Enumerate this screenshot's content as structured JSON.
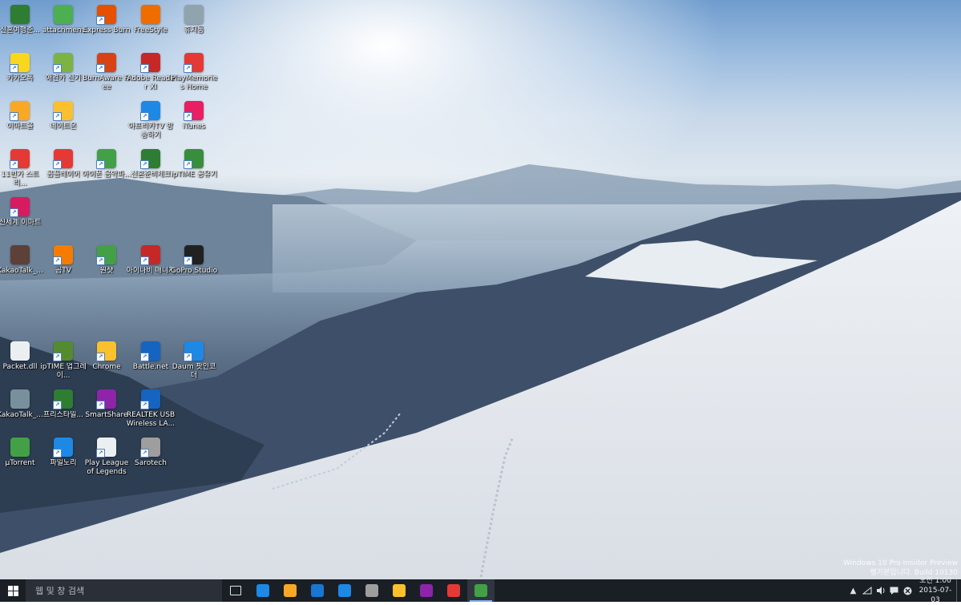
{
  "desktop": {
    "icons": [
      {
        "label": "신혼여행준...",
        "icon": "document-icon",
        "color": "#2e7d32",
        "shortcut": false
      },
      {
        "label": "attachment",
        "icon": "document-icon",
        "color": "#4caf50",
        "shortcut": false
      },
      {
        "label": "Express Burn",
        "icon": "burn-disc-icon",
        "color": "#e65100",
        "shortcut": true
      },
      {
        "label": "FreeStyle",
        "icon": "basketball-icon",
        "color": "#ef6c00",
        "shortcut": false
      },
      {
        "label": "휴지통",
        "icon": "recycle-bin-icon",
        "color": "#90a4ae",
        "shortcut": false
      },
      {
        "label": "카카오톡",
        "icon": "kakaotalk-icon",
        "color": "#f9d71c",
        "shortcut": true
      },
      {
        "label": "애견카 신기",
        "icon": "document-icon",
        "color": "#7cb342",
        "shortcut": true
      },
      {
        "label": "BurnAware Free",
        "icon": "burnaware-icon",
        "color": "#d84315",
        "shortcut": true
      },
      {
        "label": "Adobe Reader XI",
        "icon": "adobe-reader-icon",
        "color": "#c62828",
        "shortcut": true
      },
      {
        "label": "PlayMemories Home",
        "icon": "playmemories-icon",
        "color": "#e53935",
        "shortcut": true
      },
      {
        "label": "이마트몰",
        "icon": "emart-mall-icon",
        "color": "#f9a825",
        "shortcut": true
      },
      {
        "label": "네이트온",
        "icon": "nateon-icon",
        "color": "#fbc02d",
        "shortcut": true
      },
      {
        "label": "아프리카TV 방송하기",
        "icon": "afreecatv-icon",
        "color": "#1e88e5",
        "shortcut": true
      },
      {
        "label": "iTunes",
        "icon": "itunes-icon",
        "color": "#e91e63",
        "shortcut": true
      },
      {
        "label": "11번가 스트리...",
        "icon": "11st-icon",
        "color": "#e53935",
        "shortcut": true
      },
      {
        "label": "곰플레이어",
        "icon": "gomplayer-icon",
        "color": "#e53935",
        "shortcut": true
      },
      {
        "label": "아이폰 음악파...",
        "icon": "document-icon",
        "color": "#43a047",
        "shortcut": true
      },
      {
        "label": "신혼준비체크",
        "icon": "spreadsheet-icon",
        "color": "#2e7d32",
        "shortcut": true
      },
      {
        "label": "ipTIME 공유기",
        "icon": "iptime-icon",
        "color": "#388e3c",
        "shortcut": true
      },
      {
        "label": "신세계 이마트",
        "icon": "ssg-icon",
        "color": "#d81b60",
        "shortcut": true
      },
      {
        "label": "KakaoTalk_...",
        "icon": "image-file-icon",
        "color": "#5d4037",
        "shortcut": false
      },
      {
        "label": "곰TV",
        "icon": "gomtv-icon",
        "color": "#f57c00",
        "shortcut": true
      },
      {
        "label": "원샷",
        "icon": "oneshot-icon",
        "color": "#43a047",
        "shortcut": true
      },
      {
        "label": "아이나비 매니저",
        "icon": "inavi-icon",
        "color": "#c62828",
        "shortcut": true
      },
      {
        "label": "GoPro Studio",
        "icon": "gopro-icon",
        "color": "#212121",
        "shortcut": true
      },
      {
        "label": "Packet.dll",
        "icon": "dll-file-icon",
        "color": "#eceff1",
        "shortcut": false
      },
      {
        "label": "ipTIME 업그레이...",
        "icon": "iptime-upgrade-icon",
        "color": "#558b2f",
        "shortcut": true
      },
      {
        "label": "Chrome",
        "icon": "chrome-icon",
        "color": "#fbc02d",
        "shortcut": true
      },
      {
        "label": "Battle.net",
        "icon": "battlenet-icon",
        "color": "#1565c0",
        "shortcut": true
      },
      {
        "label": "Daum 팟인코더",
        "icon": "daum-potencoder-icon",
        "color": "#1e88e5",
        "shortcut": true
      },
      {
        "label": "KakaoTalk_...",
        "icon": "image-file-icon",
        "color": "#78909c",
        "shortcut": false
      },
      {
        "label": "프리스타일...",
        "icon": "freestyle-z-icon",
        "color": "#2e7d32",
        "shortcut": true
      },
      {
        "label": "SmartShare",
        "icon": "smartshare-icon",
        "color": "#8e24aa",
        "shortcut": true
      },
      {
        "label": "REALTEK USB Wireless LA...",
        "icon": "realtek-icon",
        "color": "#1565c0",
        "shortcut": true
      },
      {
        "label": "µTorrent",
        "icon": "utorrent-icon",
        "color": "#43a047",
        "shortcut": false
      },
      {
        "label": "파일노리",
        "icon": "filenori-icon",
        "color": "#1e88e5",
        "shortcut": true
      },
      {
        "label": "Play League of Legends",
        "icon": "document-icon",
        "color": "#eceff1",
        "shortcut": true
      },
      {
        "label": "Sarotech",
        "icon": "sarotech-icon",
        "color": "#9e9e9e",
        "shortcut": true
      }
    ],
    "watermark": {
      "line1": "Windows 10 Pro Insider Preview",
      "line2": "평가본입니다. Build 10130"
    }
  },
  "taskbar": {
    "search_placeholder": "웹 및 창 검색",
    "pinned": [
      {
        "name": "task-view-icon",
        "color": "#1a1f26",
        "active": false
      },
      {
        "name": "windows-store-blue-icon",
        "color": "#1e88e5",
        "active": false
      },
      {
        "name": "file-explorer-icon",
        "color": "#f9a825",
        "active": false
      },
      {
        "name": "store-icon",
        "color": "#1976d2",
        "active": false
      },
      {
        "name": "internet-explorer-icon",
        "color": "#1e88e5",
        "active": false
      },
      {
        "name": "paint-app-icon",
        "color": "#9e9e9e",
        "active": false
      },
      {
        "name": "chrome-icon",
        "color": "#fbc02d",
        "active": false
      },
      {
        "name": "smartshare-icon",
        "color": "#8e24aa",
        "active": false
      },
      {
        "name": "gomplayer-icon",
        "color": "#e53935",
        "active": false
      },
      {
        "name": "utorrent-icon",
        "color": "#43a047",
        "active": true
      }
    ],
    "clock": {
      "time": "오전 1:00",
      "date": "2015-07-03"
    }
  }
}
